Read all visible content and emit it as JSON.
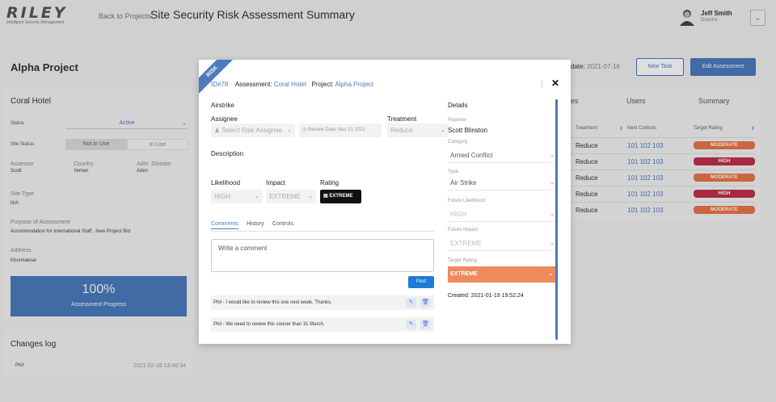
{
  "app": {
    "logo_text": "RILEY",
    "logo_subtitle": "Intelligent Security Management",
    "back_link": "Back to Projects",
    "page_title": "Site Security Risk Assessment Summary",
    "user": {
      "name": "Jeff Smith",
      "role": "Director"
    }
  },
  "project": {
    "title": "Alpha Project",
    "site": {
      "title": "Coral Hotel",
      "status_label": "Status",
      "status_value": "Active",
      "site_status_label": "Site Status",
      "site_status_options": [
        "Not in Use",
        "In Use"
      ],
      "assessor_label": "Assessor",
      "assessor_value": "Scott",
      "country_label": "Country",
      "country_value": "Yemen",
      "adm_label": "Adm. Division",
      "adm_value": "Aden",
      "site_type_label": "Site Type",
      "site_type_value": "N/A",
      "purpose_label": "Purpose of Assessment",
      "purpose_value": "Accommodation for International Staff , New Project Bid",
      "address_label": "Address",
      "address_value": "Khormaksar",
      "progress_value": "100%",
      "progress_label": "Assessment Progress"
    },
    "changes_log": {
      "title": "Changes log",
      "user": "Phil",
      "time": "2021-02-16 13:40:34"
    },
    "due_date_label": "date:",
    "due_date_value": "2021-07-16",
    "new_task_label": "New Task",
    "edit_assessment_label": "Edit Assessment",
    "summary_tabs": [
      "es",
      "Users",
      "Summary"
    ],
    "summary_headers": [
      "Treatment",
      "Next Controls",
      "Target Rating"
    ],
    "summary_rows": [
      {
        "treatment": "Reduce",
        "controls": "101 102 103",
        "rating": "MODERATE"
      },
      {
        "treatment": "Reduce",
        "controls": "101 102 103",
        "rating": "HIGH"
      },
      {
        "treatment": "Reduce",
        "controls": "101 102 103",
        "rating": "MODERATE"
      },
      {
        "treatment": "Reduce",
        "controls": "101 102 103",
        "rating": "HIGH"
      },
      {
        "treatment": "Reduce",
        "controls": "101 102 103",
        "rating": "MODERATE"
      }
    ]
  },
  "modal": {
    "ribbon": "RISK",
    "id": "ID#78",
    "assessment_label": "Assessment:",
    "assessment_value": "Coral Hotel",
    "project_label": "Project:",
    "project_value": "Alpha Project",
    "risk_name": "Airstrike",
    "assignee_label": "Assignee",
    "assignee_placeholder": "Select Risk Assignee",
    "review_date": "Review Date: Mar 31 2021",
    "treatment_label": "Treatment",
    "treatment_value": "Reduce",
    "description_label": "Description",
    "likelihood_label": "Likelihood",
    "likelihood_value": "HIGH",
    "impact_label": "Impact",
    "impact_value": "EXTREME",
    "rating_label": "Rating",
    "rating_value": "EXTREME",
    "tabs": [
      "Comments",
      "History",
      "Controls"
    ],
    "comment_placeholder": "Write a comment",
    "post_label": "Post",
    "comments": [
      "Phil - I would like to review this one next week. Thanks.",
      "Phil - We need to review this sooner than 31 March."
    ],
    "details": {
      "title": "Details",
      "reporter_label": "Reporter",
      "reporter_value": "Scott Blinston",
      "category_label": "Category",
      "category_value": "Armed Conflict",
      "type_label": "Type",
      "type_value": "Air Strike",
      "future_likelihood_label": "Future Likelihood",
      "future_likelihood_value": "HIGH",
      "future_impact_label": "Future Impact",
      "future_impact_value": "EXTREME",
      "target_rating_label": "Target Rating",
      "target_rating_value": "EXTREME",
      "created": "Created: 2021-01-19 19:52:24"
    }
  },
  "colors": {
    "accent": "#4a7bbd",
    "moderate": "#e8764a",
    "high": "#c0304a",
    "target_extreme": "#ef8a5c"
  }
}
